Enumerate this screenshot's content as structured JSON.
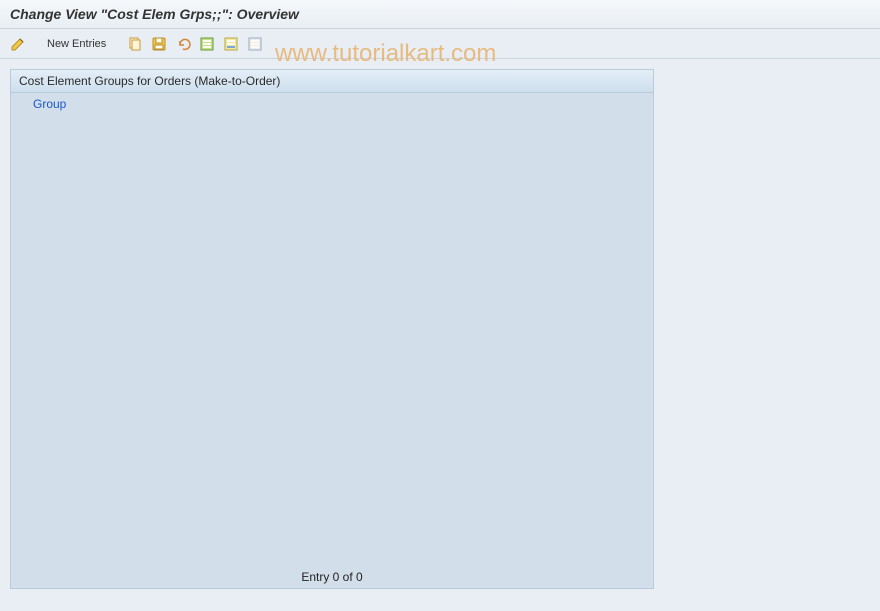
{
  "title": "Change View \"Cost Elem Grps;;\": Overview",
  "toolbar": {
    "new_entries": "New Entries"
  },
  "panel": {
    "header": "Cost Element Groups for Orders (Make-to-Order)",
    "column": "Group",
    "footer": "Entry 0 of 0"
  },
  "watermark": "www.tutorialkart.com"
}
